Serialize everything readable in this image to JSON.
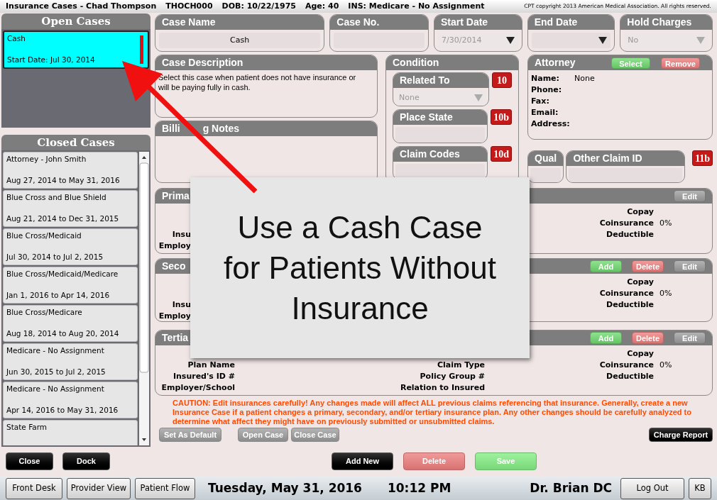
{
  "title_bar": {
    "title": "Insurance Cases - Chad Thompson",
    "patient_id": "THOCH000",
    "dob": "DOB: 10/22/1975",
    "age": "Age: 40",
    "insurance": "INS: Medicare - No Assignment",
    "copyright": "CPT copyright 2013 American Medical Association. All rights reserved."
  },
  "open_cases": {
    "title": "Open Cases",
    "items": [
      {
        "name": "Cash",
        "detail": "Start Date: Jul 30, 2014",
        "selected": true
      }
    ]
  },
  "closed_cases": {
    "title": "Closed Cases",
    "items": [
      {
        "name": "Attorney - John Smith",
        "detail": "Aug 27, 2014 to May 31, 2016",
        "selected": false
      },
      {
        "name": "Blue Cross and Blue Shield",
        "detail": "Aug 21, 2014 to Dec 31, 2015",
        "selected": false
      },
      {
        "name": "Blue Cross/Medicaid",
        "detail": "Jul 30, 2014 to Jul 2, 2015",
        "selected": false
      },
      {
        "name": "Blue Cross/Medicaid/Medicare",
        "detail": "Jan 1, 2016 to Apr 14, 2016",
        "selected": false
      },
      {
        "name": "Blue Cross/Medicare",
        "detail": "Aug 18, 2014 to Aug 20, 2014",
        "selected": false
      },
      {
        "name": "Medicare - No Assignment",
        "detail": "Jun 30, 2015 to Jul 2, 2015",
        "selected": false
      },
      {
        "name": "Medicare - No Assignment",
        "detail": "Apr 14, 2016 to May 31, 2016",
        "selected": false
      },
      {
        "name": "State Farm",
        "selected": false
      }
    ]
  },
  "left_actions": [
    {
      "label": "Close",
      "kind": "dark"
    },
    {
      "label": "Dock",
      "kind": "dark"
    }
  ],
  "fields": [
    {
      "label": "Case Name",
      "value": "Cash",
      "kind": "text"
    },
    {
      "label": "Case No.",
      "kind": "text"
    },
    {
      "label": "Start Date",
      "value": "7/30/2014",
      "kind": "date",
      "disabled": true
    },
    {
      "label": "End Date",
      "kind": "date"
    },
    {
      "label": "Hold Charges",
      "value": "No",
      "kind": "select",
      "disabled": true
    }
  ],
  "case_description": {
    "title": "Case Description",
    "text": "Select this case when patient does not have insurance or will be paying fully in cash."
  },
  "billing_notes": {
    "title_parts": [
      "Billi",
      "g Notes"
    ]
  },
  "condition": {
    "title": "Condition",
    "items": [
      {
        "label": "Related To",
        "value": "None",
        "kind": "select",
        "badge": "10",
        "disabled": true
      },
      {
        "label": "Place State",
        "kind": "text",
        "badge": "10b"
      },
      {
        "label": "Claim Codes",
        "kind": "text",
        "badge": "10d"
      }
    ]
  },
  "attorney": {
    "title": "Attorney",
    "buttons": [
      {
        "label": "Select",
        "kind": "add"
      },
      {
        "label": "Remove",
        "kind": "delete"
      }
    ],
    "rows": [
      {
        "label": "Name:",
        "value": "None"
      },
      {
        "label": "Phone:"
      },
      {
        "label": "Fax:"
      },
      {
        "label": "Email:"
      },
      {
        "label": "Address:"
      }
    ]
  },
  "qual": {
    "label": "Qual"
  },
  "other_claim_id": {
    "label": "Other Claim ID",
    "badge": "11b"
  },
  "insurances": [
    {
      "title": "Prima",
      "body_covered": true,
      "buttons": [
        {
          "label": "Edit",
          "kind": "edit"
        }
      ],
      "rows": [
        {
          "right": "Copay"
        },
        {
          "right": "Coinsurance",
          "right_value": "0%"
        },
        {
          "left": "Insu",
          "right": "Deductible"
        },
        {
          "left": "Employ"
        }
      ]
    },
    {
      "title": "Seco",
      "body_covered": true,
      "buttons": [
        {
          "label": "Add",
          "kind": "add"
        },
        {
          "label": "Delete",
          "kind": "delete"
        },
        {
          "label": "Edit",
          "kind": "edit"
        }
      ],
      "rows": [
        {
          "right": "Copay"
        },
        {
          "right": "Coinsurance",
          "right_value": "0%"
        },
        {
          "left": "Insu",
          "right": "Deductible"
        },
        {
          "left": "Employ"
        }
      ]
    },
    {
      "title": "Tertia",
      "body_covered": false,
      "buttons": [
        {
          "label": "Add",
          "kind": "add"
        },
        {
          "label": "Delete",
          "kind": "delete"
        },
        {
          "label": "Edit",
          "kind": "edit"
        }
      ],
      "rows": [
        {
          "right": "Copay"
        },
        {
          "left": "Plan Name",
          "middle": "Claim Type",
          "right": "Coinsurance",
          "right_value": "0%"
        },
        {
          "left": "Insured's ID #",
          "middle": "Policy Group #",
          "right": "Deductible"
        },
        {
          "left": "Employer/School",
          "middle": "Relation to Insured"
        }
      ]
    }
  ],
  "caution": "CAUTION: Edit insurances carefully! Any changes made will affect ALL previous claims referencing that insurance. Generally, create a new Insurance Case if a patient changes a primary, secondary, and/or tertiary insurance plan. Any other changes should be carefully analyzed to determine what affect they might have on previously submitted or unsubmitted claims.",
  "case_actions": [
    {
      "label": "Set As Default",
      "kind": "gray"
    },
    {
      "label": "Open Case",
      "kind": "gray"
    },
    {
      "label": "Close Case",
      "kind": "gray"
    },
    {
      "label": "Charge Report",
      "kind": "dark"
    }
  ],
  "main_actions": [
    {
      "label": "Add New",
      "kind": "dark"
    },
    {
      "label": "Delete",
      "kind": "delete"
    },
    {
      "label": "Save",
      "kind": "save"
    }
  ],
  "taskbar": {
    "nav": [
      "Front Desk",
      "Provider View",
      "Patient Flow"
    ],
    "date": "Tuesday, May 31, 2016",
    "time": "10:12 PM",
    "user": "Dr. Brian DC",
    "buttons": [
      "Log Out",
      "KB"
    ]
  },
  "callout": {
    "text": "Use a Cash Case\nfor Patients Without\nInsurance"
  }
}
